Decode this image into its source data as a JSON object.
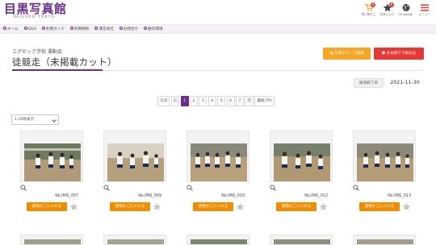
{
  "header": {
    "logo": "目黒写真館",
    "logo_sub": "MEGURO TOKYO",
    "icons": [
      {
        "name": "cart",
        "label": "買い物かご",
        "badge": "0",
        "color": "#f5a623"
      },
      {
        "name": "star",
        "label": "お気に入り",
        "badge": "0",
        "color": "#444444"
      },
      {
        "name": "globe",
        "label": "language",
        "badge": "",
        "color": "#444444"
      },
      {
        "name": "menu",
        "label": "メニュー",
        "badge": "",
        "color": "#e53935"
      }
    ]
  },
  "nav": {
    "items": [
      "ホーム",
      "Q&A",
      "利用ガイド",
      "利用規約",
      "運営会社",
      "お問合せ",
      "動作環境"
    ]
  },
  "page": {
    "subtitle": "エグゼック学校 運動会",
    "title": "徒競走（未掲載カット）",
    "group_button": "写真グループ選択",
    "cart_button": "かお探りで絞込む",
    "deadline_label": "販売終了日",
    "deadline_value": "2021-11-30",
    "per_page": "1-20枚表示"
  },
  "pager": {
    "first": "先頭",
    "prev": "前",
    "pages": [
      "1",
      "2",
      "3",
      "4",
      "5",
      "6",
      "7"
    ],
    "current": "1",
    "next": "次",
    "last": "最後(7P)"
  },
  "photos": [
    {
      "code": "No.IMG_007",
      "add_label": "買物かごに入れる"
    },
    {
      "code": "No.IMG_009",
      "add_label": "買物かごに入れる"
    },
    {
      "code": "No.IMG_010",
      "add_label": "買物かごに入れる"
    },
    {
      "code": "No.IMG_012",
      "add_label": "買物かごに入れる"
    },
    {
      "code": "No.IMG_013",
      "add_label": "買物かごに入れる"
    }
  ],
  "colors": {
    "brand": "#6b2f86",
    "orange": "#f08c00",
    "red": "#e53935",
    "group_button": "#f5a623"
  }
}
